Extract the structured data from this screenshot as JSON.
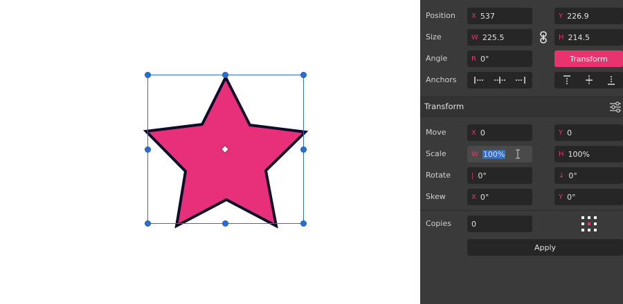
{
  "position": {
    "label": "Position",
    "x_axis": "X",
    "x": "537",
    "y_axis": "Y",
    "y": "226.9"
  },
  "size": {
    "label": "Size",
    "w_axis": "W",
    "w": "225.5",
    "h_axis": "H",
    "h": "214.5",
    "lock_icon": "link-icon"
  },
  "angle": {
    "label": "Angle",
    "r_axis": "R",
    "r": "0°",
    "transform_button": "Transform"
  },
  "anchors": {
    "label": "Anchors",
    "horizontal": [
      "align-left-icon",
      "align-center-h-icon",
      "align-right-icon"
    ],
    "vertical": [
      "align-top-icon",
      "align-center-v-icon",
      "align-bottom-icon"
    ]
  },
  "transform_section": {
    "title": "Transform",
    "settings_icon": "sliders-icon"
  },
  "move": {
    "label": "Move",
    "x_axis": "X",
    "x": "0",
    "y_axis": "Y",
    "y": "0"
  },
  "scale": {
    "label": "Scale",
    "w_axis": "W",
    "w": "100%",
    "h_axis": "H",
    "h": "100%"
  },
  "rotate": {
    "label": "Rotate",
    "a_axis": "|",
    "a": "0°",
    "b_axis": "↓",
    "b": "0°"
  },
  "skew": {
    "label": "Skew",
    "x_axis": "X",
    "x": "0°",
    "y_axis": "Y",
    "y": "0°"
  },
  "copies": {
    "label": "Copies",
    "value": "0",
    "grid_icon": "dot-grid-icon"
  },
  "apply_button": "Apply",
  "colors": {
    "accent": "#e8336f",
    "star_fill": "#e8307a",
    "star_stroke": "#0d0d2b",
    "selection": "#2a6fd0"
  }
}
